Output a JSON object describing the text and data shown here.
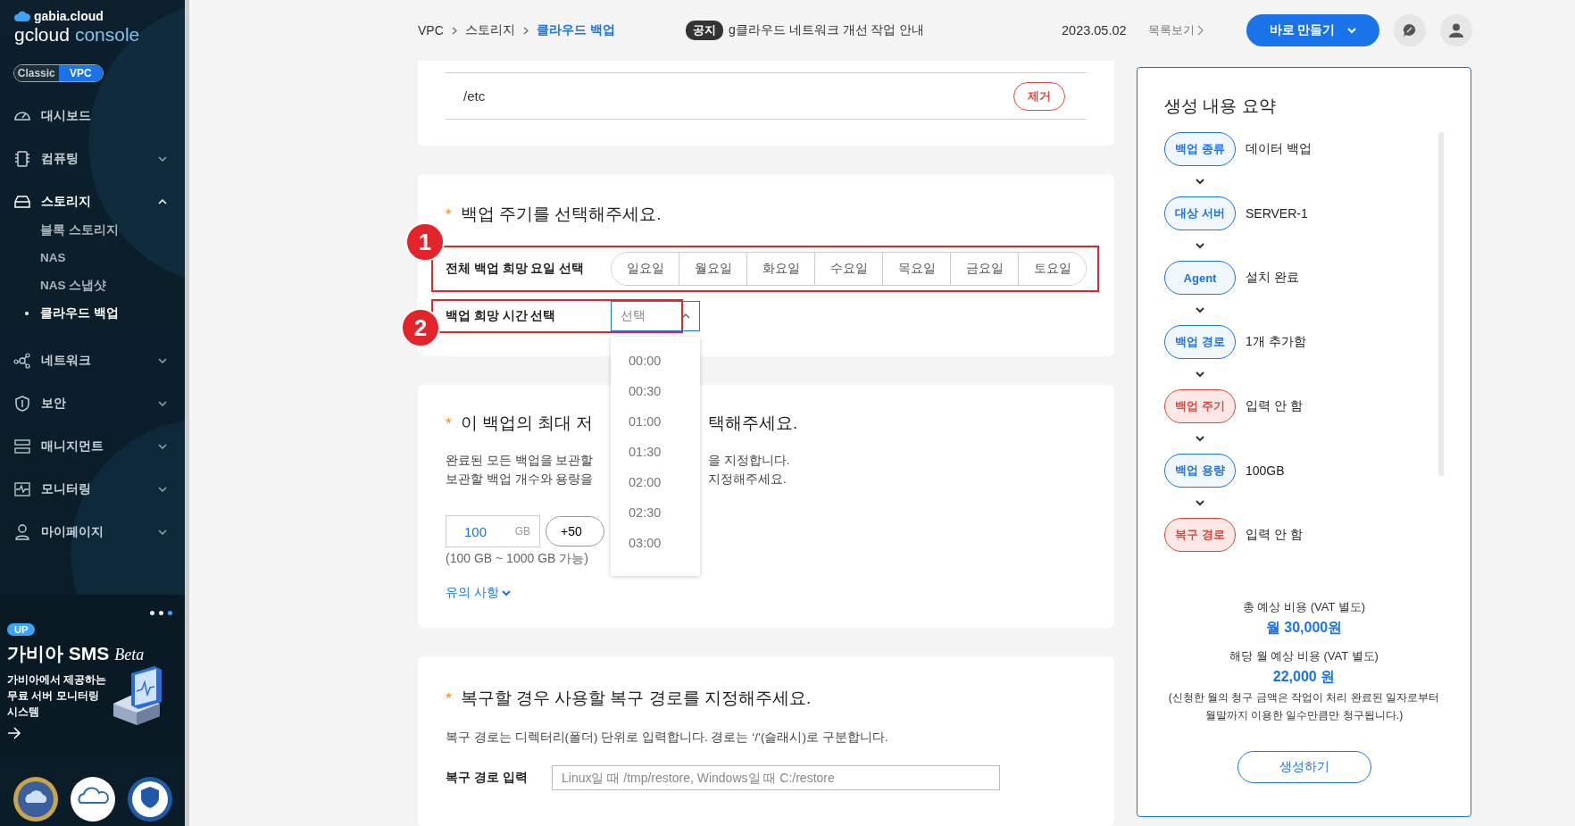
{
  "sidebar": {
    "brand": "gabia.cloud",
    "product_name": "gcloud",
    "product_suffix": "console",
    "modes": [
      {
        "label": "Classic",
        "selected": false
      },
      {
        "label": "VPC",
        "selected": true
      }
    ],
    "menu": [
      {
        "label": "대시보드",
        "kind": "gauge",
        "expandable": false
      },
      {
        "label": "컴퓨팅",
        "kind": "chip",
        "expandable": true,
        "expanded": false
      },
      {
        "label": "스토리지",
        "kind": "drive",
        "expandable": true,
        "expanded": true,
        "children": [
          {
            "label": "블록 스토리지",
            "selected": false
          },
          {
            "label": "NAS",
            "selected": false
          },
          {
            "label": "NAS 스냅샷",
            "selected": false
          },
          {
            "label": "클라우드 백업",
            "selected": true
          }
        ]
      },
      {
        "label": "네트워크",
        "kind": "network",
        "expandable": true,
        "expanded": false
      },
      {
        "label": "보안",
        "kind": "shield",
        "expandable": true,
        "expanded": false
      },
      {
        "label": "매니지먼트",
        "kind": "server",
        "expandable": true,
        "expanded": false
      },
      {
        "label": "모니터링",
        "kind": "monitor",
        "expandable": true,
        "expanded": false
      },
      {
        "label": "마이페이지",
        "kind": "user",
        "expandable": true,
        "expanded": false
      }
    ],
    "banner": {
      "slides": [
        {
          "selected": false
        },
        {
          "selected": false
        },
        {
          "selected": true
        }
      ],
      "badge": "UP",
      "title": "가비아 SMS",
      "title_suffix": "Beta",
      "text": [
        "가비아에서 제공하는",
        "무료 서버 모니터링",
        "시스템"
      ]
    }
  },
  "topbar": {
    "breadcrumb": [
      {
        "label": "VPC",
        "selected": false
      },
      {
        "label": "스토리지",
        "selected": false
      },
      {
        "label": "클라우드 백업",
        "selected": true
      }
    ],
    "notice": {
      "badge": "공지",
      "text": "g클라우드 네트워크 개선 작업 안내"
    },
    "date": "2023.05.02",
    "list_link": "목록보기",
    "create_button": "바로 만들기"
  },
  "path_section": {
    "paths": [
      {
        "path": "/etc",
        "action": "제거"
      }
    ]
  },
  "schedule_section": {
    "required_mark": "*",
    "title": "백업 주기를 선택해주세요.",
    "day_row": {
      "marker": "1",
      "label": "전체 백업 희망 요일 선택",
      "days": [
        {
          "label": "일요일",
          "selected": false
        },
        {
          "label": "월요일",
          "selected": false
        },
        {
          "label": "화요일",
          "selected": false
        },
        {
          "label": "수요일",
          "selected": false
        },
        {
          "label": "목요일",
          "selected": false
        },
        {
          "label": "금요일",
          "selected": false
        },
        {
          "label": "토요일",
          "selected": false
        }
      ]
    },
    "time_row": {
      "marker": "2",
      "label": "백업 희망 시간 선택",
      "select": {
        "placeholder": "선택",
        "expanded": true,
        "options": [
          "00:00",
          "00:30",
          "01:00",
          "01:30",
          "02:00",
          "02:30",
          "03:00"
        ]
      }
    }
  },
  "capacity_section": {
    "required_mark": "*",
    "title_parts": [
      "이 백업의 최대 저",
      "택해주세요."
    ],
    "description": [
      [
        "완료된 모든 백업을 보관할",
        "을 지정합니다."
      ],
      [
        "보관할 백업 개수와 용량을",
        "지정해주세요."
      ]
    ],
    "capacity": {
      "value": "100",
      "unit": "GB"
    },
    "increment_button": "+50",
    "range_note": "(100 GB ~ 1000 GB 가능)",
    "notes_link": "유의 사항"
  },
  "restore_section": {
    "required_mark": "*",
    "title": "복구할 경우 사용할 복구 경로를 지정해주세요.",
    "description": "복구 경로는 디렉터리(폴더) 단위로 입력합니다. 경로는 ‘/’(슬래시)로 구분합니다.",
    "field_label": "복구 경로 입력",
    "placeholder": "Linux일 때 /tmp/restore, Windows일 때 C:/restore"
  },
  "summary": {
    "title": "생성 내용 요약",
    "items": [
      {
        "label": "백업 종류",
        "value": "데이터 백업",
        "filled": true
      },
      {
        "label": "대상 서버",
        "value": "SERVER-1",
        "filled": true
      },
      {
        "label": "Agent",
        "value": "설치 완료",
        "filled": true
      },
      {
        "label": "백업 경로",
        "value": "1개 추가함",
        "filled": true
      },
      {
        "label": "백업 주기",
        "value": "입력 안 함",
        "filled": false
      },
      {
        "label": "백업 용량",
        "value": "100GB",
        "filled": true
      },
      {
        "label": "복구 경로",
        "value": "입력 안 함",
        "filled": false
      }
    ],
    "total_label": "총 예상 비용 (VAT 별도)",
    "total_value": "월 30,000원",
    "month_label": "해당 월 예상 비용 (VAT 별도)",
    "month_value": "22,000 원",
    "note": [
      "(신청한 월의 청구 금액은 작업이 처리 완료된 일자로부터",
      "월말까지 이용한 일수만큼만 청구됩니다.)"
    ],
    "create_button": "생성하기"
  }
}
